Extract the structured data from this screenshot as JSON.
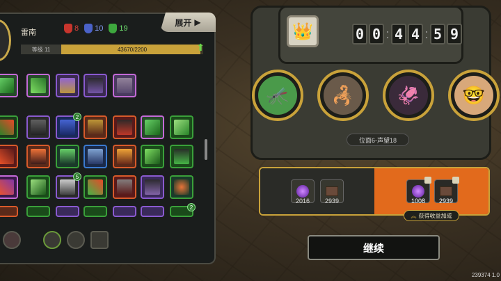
{
  "hero": {
    "name": "雷南",
    "level_label": "等级 11",
    "xp_text": "43670/2200",
    "xp_progress": 0.98
  },
  "counts": [
    {
      "icon": "red-mask-icon",
      "value": "8",
      "color": "#e0443a"
    },
    {
      "icon": "blue-mask-icon",
      "value": "10",
      "color": "#5b7cf0"
    },
    {
      "icon": "green-mask-icon",
      "value": "19",
      "color": "#4fc24f"
    }
  ],
  "expand_label": "展开",
  "expand_arrow": "▶",
  "timer": {
    "d1": "0",
    "d2": "0",
    "d3": "4",
    "d4": "4",
    "d5": "5",
    "d6": "9"
  },
  "position_label": "位面6-声望18",
  "rewards_left": [
    {
      "icon": "purple-orb-icon",
      "value": "2016"
    },
    {
      "icon": "book-icon",
      "value": "2939"
    }
  ],
  "rewards_right": [
    {
      "icon": "purple-orb-icon",
      "value": "1008"
    },
    {
      "icon": "book-icon",
      "value": "2939"
    }
  ],
  "bonus_label": "获得收益加成",
  "continue_label": "继续",
  "version": "239374 1.0",
  "badges": {
    "a": "2",
    "b": "5",
    "c": "2"
  },
  "crown_glyph": "👑",
  "slot_glyphs": {
    "s1": "🦟",
    "s2": "🦂",
    "s3": "🦑",
    "s4": "🤓"
  }
}
